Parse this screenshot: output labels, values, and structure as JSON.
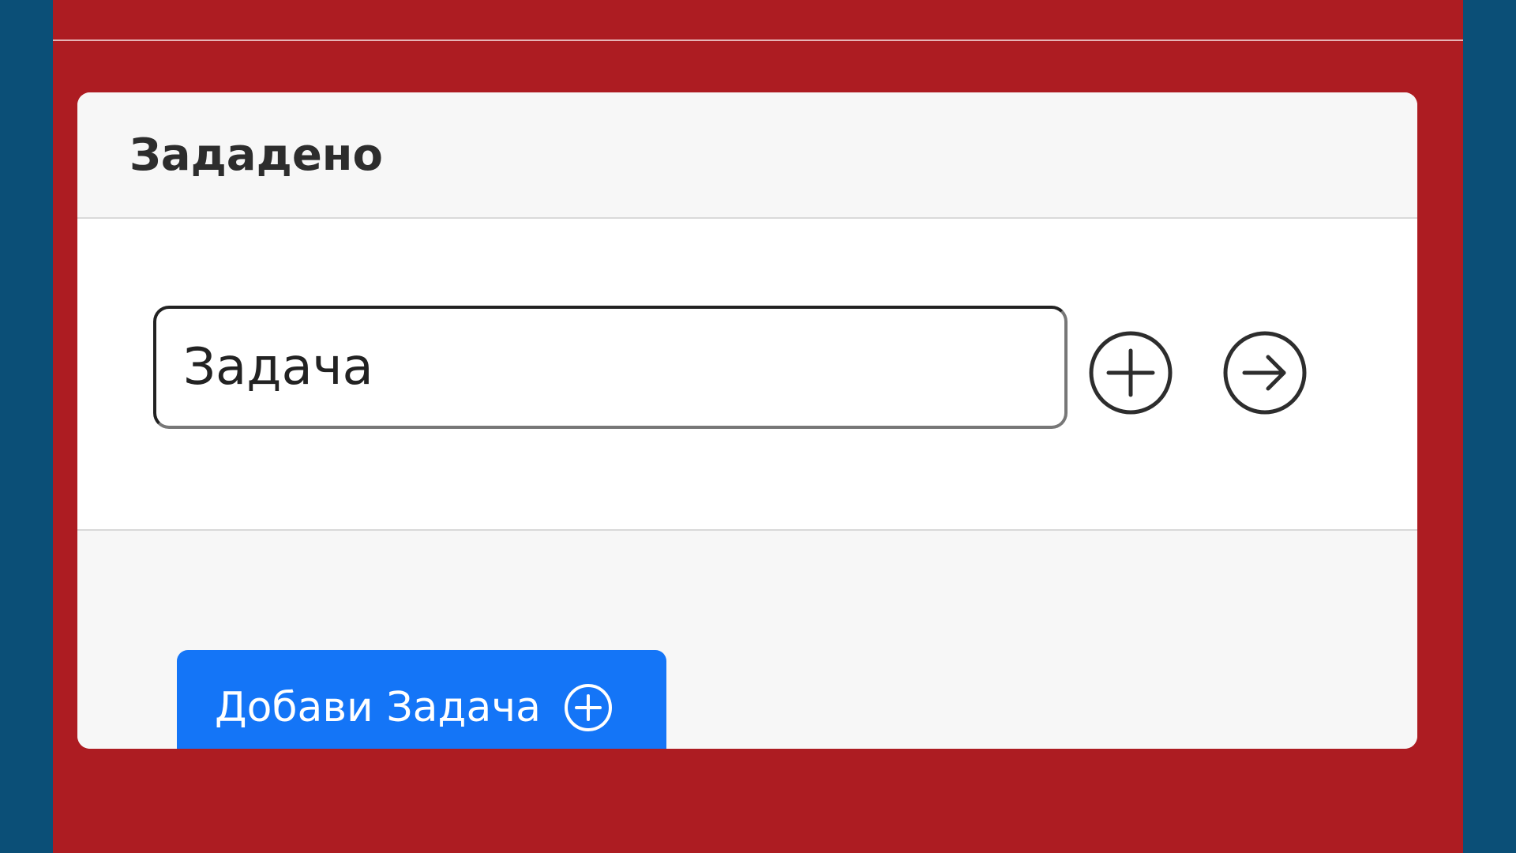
{
  "colors": {
    "outer_background": "#0b4f77",
    "board_background": "#ad1c22",
    "card_background": "#f7f7f7",
    "card_body_background": "#ffffff",
    "primary_button": "#1475f7",
    "icon_stroke": "#2d2d2d"
  },
  "card": {
    "title": "Зададено"
  },
  "task_row": {
    "input_value": "Задача",
    "add_icon": "plus-circle-icon",
    "move_icon": "arrow-right-circle-icon"
  },
  "footer": {
    "add_task_label": "Добави Задача",
    "add_task_icon": "plus-circle-icon"
  }
}
